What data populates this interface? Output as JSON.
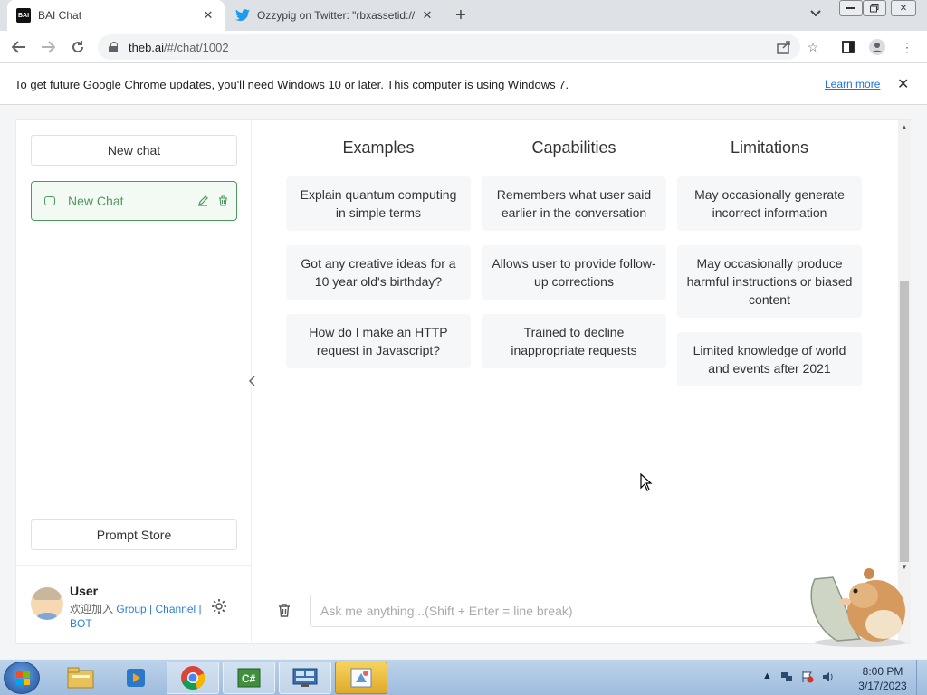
{
  "browser": {
    "tabs": [
      {
        "title": "BAI Chat",
        "favicon": "BAI"
      },
      {
        "title": "Ozzypig on Twitter: \"rbxassetid://",
        "favicon": "twitter-bird"
      }
    ],
    "url_host": "theb.ai",
    "url_path": "/#/chat/1002"
  },
  "infobar": {
    "message": "To get future Google Chrome updates, you'll need Windows 10 or later. This computer is using Windows 7.",
    "learn_more": "Learn more"
  },
  "sidebar": {
    "new_chat_button": "New chat",
    "chats": [
      {
        "label": "New Chat"
      }
    ],
    "prompt_store_button": "Prompt Store",
    "user": {
      "name": "User",
      "join_text": "欢迎加入",
      "group": "Group",
      "channel": "Channel",
      "bot": "BOT",
      "sep": " | "
    }
  },
  "main": {
    "columns": [
      {
        "title": "Examples",
        "items": [
          "Explain quantum computing in simple terms",
          "Got any creative ideas for a 10 year old's birthday?",
          "How do I make an HTTP request in Javascript?"
        ]
      },
      {
        "title": "Capabilities",
        "items": [
          "Remembers what user said earlier in the conversation",
          "Allows user to provide follow-up corrections",
          "Trained to decline inappropriate requests"
        ]
      },
      {
        "title": "Limitations",
        "items": [
          "May occasionally generate incorrect information",
          "May occasionally produce harmful instructions or biased content",
          "Limited knowledge of world and events after 2021"
        ]
      }
    ],
    "input_placeholder": "Ask me anything...(Shift + Enter = line break)"
  },
  "taskbar": {
    "time": "8:00 PM",
    "date": "3/17/2023",
    "apps": [
      "explorer",
      "media-player",
      "chrome",
      "csharp-editor",
      "remote-desktop",
      "paint"
    ]
  },
  "colors": {
    "accent_green": "#4d9a5f",
    "link_blue": "#2f7fd6"
  }
}
